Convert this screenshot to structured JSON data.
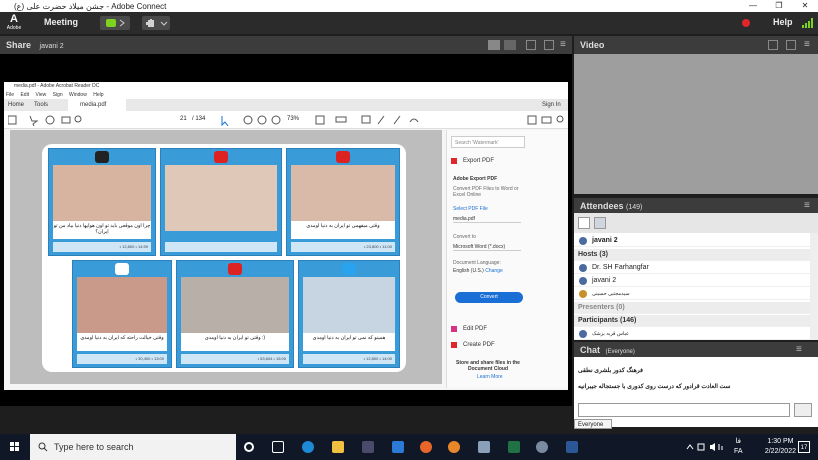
{
  "window": {
    "title": "جشن میلاد حضرت علی (ع) - Adobe Connect",
    "controls": [
      "—",
      "❐",
      "✕"
    ]
  },
  "menubar": {
    "logo_text": "A",
    "logo_sub": "Adobe",
    "meeting_label": "Meeting",
    "help_label": "Help"
  },
  "share_pod": {
    "title": "Share",
    "presenter": "javani 2"
  },
  "acrobat": {
    "title": "media.pdf - Adobe Acrobat Reader DC",
    "menu": [
      "File",
      "Edit",
      "View",
      "Sign",
      "Window",
      "Help"
    ],
    "tabs": [
      "Home",
      "Tools",
      "media.pdf"
    ],
    "sign_in": "Sign In",
    "page_current": "21",
    "page_total": "/ 134",
    "zoom": "73%",
    "right_panel": {
      "search_placeholder": "Search 'Watermark'",
      "export_pdf": "Export PDF",
      "adobe_export": "Adobe Export PDF",
      "desc": "Convert PDF Files to Word or Excel Online",
      "select_file": "Select PDF File",
      "file_name": "media.pdf",
      "convert_to": "Convert to",
      "format": "Microsoft Word (*.docx)",
      "doc_language": "Document Language:",
      "language": "English (U.S.)",
      "change": "Change",
      "convert_btn": "Convert",
      "edit_pdf": "Edit PDF",
      "create_pdf": "Create PDF",
      "store_share": "Store and share files in the Document Cloud",
      "learn_more": "Learn More"
    },
    "tiles": [
      {
        "caption": "چرا اون موقعی باید تو اون هوایها دنیا بیاد من تو ایران؟",
        "stat": "• 12,800 • 14:59"
      },
      {
        "caption": "",
        "stat": ""
      },
      {
        "caption": "وقتی میفهمی تو ایران به دنیا اومدی",
        "stat": "• 23,800 • 11:00"
      },
      {
        "caption": "وقتی خیالت راحته که ایران به دنیا اومدی",
        "stat": "• 30,400 • 13:00"
      },
      {
        "caption": "وقتی تو ایران به دنیا اومدی :)",
        "stat": "• 53,604 • 15:00"
      },
      {
        "caption": "همینو که نمی تو ایران به دنیا اومدی",
        "stat": "• 12,800 • 14:00"
      }
    ]
  },
  "video_pod": {
    "title": "Video"
  },
  "attendees": {
    "title": "Attendees",
    "count": "(149)",
    "me": "javani 2",
    "hosts_label": "Hosts (3)",
    "hosts": [
      "Dr. SH Farhangfar",
      "javani 2",
      "سیدمجتبی حسینی"
    ],
    "presenters_label": "Presenters (0)",
    "participants_label": "Participants (146)",
    "participants": [
      "عباس قربه بزشک"
    ]
  },
  "chat": {
    "title": "Chat",
    "scope": "(Everyone)",
    "messages": [
      "فرهنگ کدور بلشری نطقی",
      "ست العادت قرادور که درست روی کدوری با جستجاله جیبرانیه"
    ],
    "tab": "Everyone"
  },
  "taskbar": {
    "search_placeholder": "Type here to search",
    "lang_top": "فا",
    "lang_bottom": "FA",
    "time": "1:30 PM",
    "date": "2/22/2022",
    "notif_count": "17"
  }
}
